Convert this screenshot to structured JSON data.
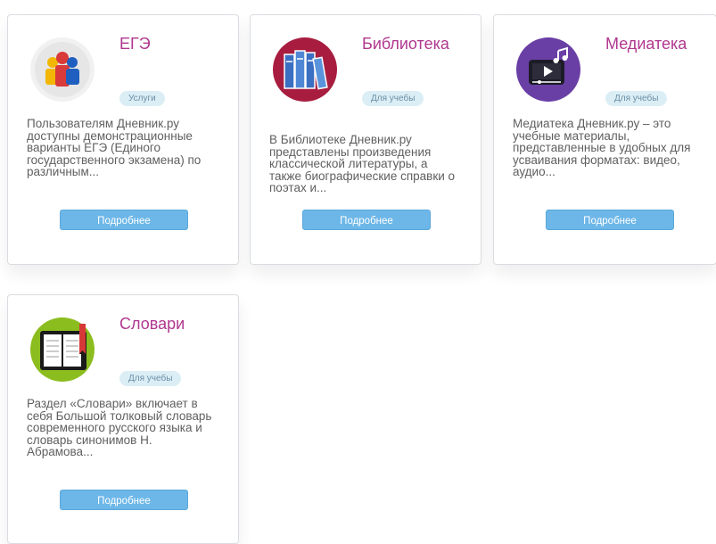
{
  "cards": [
    {
      "title": "ЕГЭ",
      "badge": "Услуги",
      "description": "Пользователям Дневник.ру доступны демонстрационные варианты ЕГЭ (Единого государственного экзамена) по различным...",
      "button": "Подробнее",
      "icon": "ege-people-icon"
    },
    {
      "title": "Библиотека",
      "badge": "Для учебы",
      "description": "В Библиотеке Дневник.ру представлены произведения классической литературы, а также биографические справки о поэтах и...",
      "button": "Подробнее",
      "icon": "library-books-icon"
    },
    {
      "title": "Медиатека",
      "badge": "Для учебы",
      "description": "Медиатека Дневник.ру – это учебные материалы, представленные в удобных для усваивания форматах: видео, аудио...",
      "button": "Подробнее",
      "icon": "media-player-icon"
    },
    {
      "title": "Словари",
      "badge": "Для учебы",
      "description": "Раздел «Словари» включает в себя Большой толковый словарь современного русского языка и словарь синонимов Н. Абрамова...",
      "button": "Подробнее",
      "icon": "dictionary-book-icon"
    }
  ],
  "colors": {
    "title": "#b0378f",
    "badge_bg": "#dbeef5",
    "button_bg": "#6db7e8"
  }
}
